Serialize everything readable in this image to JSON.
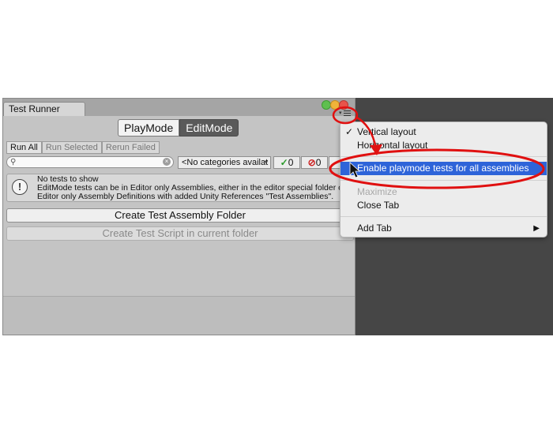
{
  "window": {
    "tab_title": "Test Runner",
    "mode_tabs": [
      {
        "label": "PlayMode",
        "selected": false
      },
      {
        "label": "EditMode",
        "selected": true
      }
    ]
  },
  "toolbar": {
    "run_all": "Run All",
    "run_selected": "Run Selected",
    "rerun_failed": "Rerun Failed"
  },
  "filter": {
    "search_value": "",
    "category_selected": "<No categories availat",
    "passed_count": "0",
    "failed_count": "0"
  },
  "message": {
    "line1": "No tests to show",
    "line2": "EditMode tests can be in Editor only Assemblies, either in the editor special folder or",
    "line3": "Editor only Assembly Definitions with added Unity References \"Test Assemblies\"."
  },
  "buttons": {
    "create_folder": "Create Test Assembly Folder",
    "create_script": "Create Test Script in current folder"
  },
  "context_menu": {
    "items": [
      {
        "label": "Vertical layout",
        "checked": true
      },
      {
        "label": "Horizontal layout",
        "checked": false
      },
      {
        "label": "Enable playmode tests for all assemblies",
        "highlighted": true
      },
      {
        "label": "Maximize",
        "disabled": true
      },
      {
        "label": "Close Tab"
      },
      {
        "label": "Add Tab",
        "submenu_arrow": "▶"
      }
    ]
  },
  "colors": {
    "menu_highlight": "#2e64d9",
    "annotation_red": "#e01010",
    "backdrop": "#464646"
  }
}
